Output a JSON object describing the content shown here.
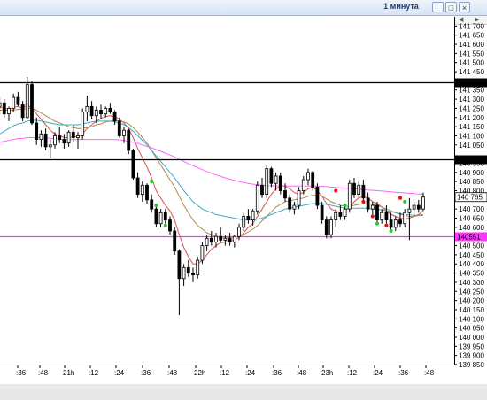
{
  "window": {
    "title": "1 минута"
  },
  "colors": {
    "candle_up": "#ffffff",
    "candle_down": "#000000",
    "ma_fast": "#d9534f",
    "ma_mid": "#3fa9c9",
    "ma_slow": "#ff66ff",
    "ma_brown": "#b08a4a",
    "level_line": "#000000",
    "support_line": "#ff33ff",
    "signal_red": "#ff0000",
    "signal_green": "#22cc22"
  },
  "chart_data": {
    "type": "candlestick",
    "title": "",
    "ylim": [
      139850,
      141750
    ],
    "y_tick_labels": [
      "141 700",
      "141 650",
      "141 600",
      "141 550",
      "141 500",
      "141 450",
      "141 350",
      "141 300",
      "141 250",
      "141 200",
      "141 150",
      "141 100",
      "141 050",
      "140 950",
      "140 900",
      "140 850",
      "140 800",
      "140 700",
      "140 650",
      "140 600",
      "140 500",
      "140 450",
      "140 400",
      "140 350",
      "140 300",
      "140 250",
      "140 200",
      "140 150",
      "140 100",
      "140 050",
      "140 000",
      "139 950",
      "139 900",
      "139 850"
    ],
    "y_ticks": [
      141700,
      141650,
      141600,
      141550,
      141500,
      141450,
      141350,
      141300,
      141250,
      141200,
      141150,
      141100,
      141050,
      140950,
      140900,
      140850,
      140800,
      140700,
      140650,
      140600,
      140500,
      140450,
      140400,
      140350,
      140300,
      140250,
      140200,
      140150,
      140100,
      140050,
      140000,
      139950,
      139900,
      139850
    ],
    "x_tick_labels": [
      ":36",
      ":48",
      "21h",
      ":12",
      ":24",
      ":36",
      ":48",
      "22h",
      ":12",
      ":24",
      ":36",
      ":48",
      "23h",
      ":12",
      ":24",
      ":36",
      ":48"
    ],
    "levels": [
      {
        "value": 141392,
        "label": "141392",
        "color": "#000000"
      },
      {
        "value": 140970,
        "label": "140970",
        "color": "#000000"
      },
      {
        "value": 140551,
        "label": "140551",
        "color": "#ff33ff"
      }
    ],
    "last_price": {
      "value": 140765,
      "label": "140 765"
    },
    "candles": [
      [
        141290,
        141320,
        141230,
        141260
      ],
      [
        141260,
        141300,
        141200,
        141240
      ],
      [
        141240,
        141280,
        141190,
        141260
      ],
      [
        141260,
        141310,
        141220,
        141280
      ],
      [
        141280,
        141300,
        141200,
        141220
      ],
      [
        141220,
        141260,
        141180,
        141250
      ],
      [
        141250,
        141330,
        141230,
        141310
      ],
      [
        141310,
        141340,
        141260,
        141270
      ],
      [
        141270,
        141290,
        141180,
        141200
      ],
      [
        141200,
        141420,
        141190,
        141380
      ],
      [
        141380,
        141400,
        141160,
        141170
      ],
      [
        141170,
        141200,
        141050,
        141080
      ],
      [
        141080,
        141130,
        141040,
        141110
      ],
      [
        141110,
        141140,
        141020,
        141040
      ],
      [
        141040,
        141080,
        140980,
        141050
      ],
      [
        141050,
        141120,
        141030,
        141100
      ],
      [
        141100,
        141150,
        141060,
        141080
      ],
      [
        141080,
        141110,
        141030,
        141060
      ],
      [
        141060,
        141130,
        141040,
        141120
      ],
      [
        141120,
        141160,
        141070,
        141090
      ],
      [
        141090,
        141120,
        141030,
        141100
      ],
      [
        141100,
        141250,
        141080,
        141230
      ],
      [
        141230,
        141320,
        141180,
        141260
      ],
      [
        141260,
        141290,
        141190,
        141210
      ],
      [
        141210,
        141260,
        141170,
        141240
      ],
      [
        141240,
        141270,
        141190,
        141220
      ],
      [
        141220,
        141260,
        141200,
        141250
      ],
      [
        141250,
        141280,
        141220,
        141230
      ],
      [
        141230,
        141240,
        141160,
        141180
      ],
      [
        141180,
        141200,
        141090,
        141100
      ],
      [
        141100,
        141150,
        141060,
        141130
      ],
      [
        141130,
        141140,
        141000,
        141020
      ],
      [
        141020,
        141030,
        140860,
        140870
      ],
      [
        140870,
        140900,
        140760,
        140780
      ],
      [
        140780,
        140850,
        140740,
        140830
      ],
      [
        140830,
        140840,
        140730,
        140750
      ],
      [
        140750,
        140780,
        140680,
        140700
      ],
      [
        140700,
        140720,
        140600,
        140620
      ],
      [
        140620,
        140700,
        140600,
        140680
      ],
      [
        140680,
        140700,
        140620,
        140640
      ],
      [
        140640,
        140660,
        140560,
        140580
      ],
      [
        140580,
        140600,
        140450,
        140470
      ],
      [
        140470,
        140480,
        140120,
        140320
      ],
      [
        140320,
        140400,
        140280,
        140380
      ],
      [
        140380,
        140420,
        140330,
        140350
      ],
      [
        140350,
        140380,
        140300,
        140340
      ],
      [
        140340,
        140440,
        140320,
        140420
      ],
      [
        140420,
        140520,
        140400,
        140500
      ],
      [
        140500,
        140560,
        140470,
        140540
      ],
      [
        140540,
        140580,
        140500,
        140520
      ],
      [
        140520,
        140570,
        140490,
        140550
      ],
      [
        140550,
        140600,
        140520,
        140530
      ],
      [
        140530,
        140560,
        140500,
        140540
      ],
      [
        140540,
        140570,
        140500,
        140520
      ],
      [
        140520,
        140560,
        140490,
        140550
      ],
      [
        140550,
        140620,
        140530,
        140600
      ],
      [
        140600,
        140680,
        140580,
        140660
      ],
      [
        140660,
        140700,
        140620,
        140640
      ],
      [
        140640,
        140700,
        140610,
        140690
      ],
      [
        140690,
        140850,
        140670,
        140830
      ],
      [
        140830,
        140870,
        140760,
        140780
      ],
      [
        140780,
        140940,
        140760,
        140920
      ],
      [
        140920,
        140930,
        140820,
        140840
      ],
      [
        140840,
        140900,
        140800,
        140880
      ],
      [
        140880,
        140900,
        140780,
        140800
      ],
      [
        140800,
        140840,
        140740,
        140760
      ],
      [
        140760,
        140780,
        140680,
        140700
      ],
      [
        140700,
        140740,
        140670,
        140720
      ],
      [
        140720,
        140820,
        140700,
        140800
      ],
      [
        140800,
        140880,
        140780,
        140860
      ],
      [
        140860,
        140920,
        140830,
        140900
      ],
      [
        140900,
        140910,
        140800,
        140820
      ],
      [
        140820,
        140840,
        140700,
        140720
      ],
      [
        140720,
        140740,
        140620,
        140640
      ],
      [
        140640,
        140660,
        140540,
        140560
      ],
      [
        140560,
        140660,
        140540,
        140640
      ],
      [
        140640,
        140700,
        140600,
        140680
      ],
      [
        140680,
        140720,
        140640,
        140660
      ],
      [
        140660,
        140720,
        140640,
        140700
      ],
      [
        140700,
        140860,
        140680,
        140840
      ],
      [
        140840,
        140870,
        140760,
        140780
      ],
      [
        140780,
        140850,
        140760,
        140830
      ],
      [
        140830,
        140860,
        140740,
        140760
      ],
      [
        140760,
        140790,
        140680,
        140700
      ],
      [
        140700,
        140740,
        140650,
        140720
      ],
      [
        140720,
        140740,
        140620,
        140640
      ],
      [
        140640,
        140700,
        140620,
        140680
      ],
      [
        140680,
        140720,
        140620,
        140640
      ],
      [
        140640,
        140680,
        140580,
        140600
      ],
      [
        140600,
        140660,
        140580,
        140640
      ],
      [
        140640,
        140680,
        140600,
        140620
      ],
      [
        140620,
        140700,
        140600,
        140680
      ],
      [
        140680,
        140760,
        140530,
        140700
      ],
      [
        140700,
        140740,
        140660,
        140720
      ],
      [
        140720,
        140750,
        140680,
        140700
      ],
      [
        140700,
        140790,
        140690,
        140765
      ]
    ],
    "series": [
      {
        "name": "",
        "color": "#d9534f",
        "values": [
          141260,
          141255,
          141250,
          141255,
          141250,
          141245,
          141255,
          141260,
          141250,
          141270,
          141250,
          141220,
          141190,
          141160,
          141130,
          141110,
          141100,
          141090,
          141090,
          141095,
          141095,
          141110,
          141140,
          141160,
          141180,
          141195,
          141205,
          141210,
          141205,
          141190,
          141170,
          141140,
          141090,
          141030,
          140980,
          140930,
          140870,
          140800,
          140760,
          140720,
          140690,
          140640,
          140560,
          140490,
          140440,
          140400,
          140400,
          140420,
          140450,
          140480,
          140500,
          140515,
          140520,
          140525,
          140530,
          140545,
          140570,
          140600,
          140620,
          140660,
          140700,
          140740,
          140780,
          140810,
          140825,
          140825,
          140810,
          140790,
          140780,
          140790,
          140810,
          140820,
          140800,
          140770,
          140730,
          140700,
          140690,
          140680,
          140690,
          140710,
          140740,
          140760,
          140770,
          140760,
          140740,
          140730,
          140710,
          140690,
          140670,
          140660,
          140650,
          140645,
          140650,
          140660,
          140670,
          140690
        ]
      },
      {
        "name": "",
        "color": "#b08a4a",
        "values": [
          141240,
          141240,
          141240,
          141240,
          141240,
          141240,
          141240,
          141245,
          141245,
          141250,
          141250,
          141240,
          141225,
          141210,
          141195,
          141180,
          141170,
          141160,
          141150,
          141145,
          141140,
          141140,
          141145,
          141150,
          141160,
          141165,
          141175,
          141180,
          141185,
          141180,
          141175,
          141165,
          141145,
          141120,
          141090,
          141060,
          141020,
          140980,
          140940,
          140900,
          140860,
          140820,
          140770,
          140720,
          140680,
          140640,
          140610,
          140590,
          140570,
          140560,
          140550,
          140545,
          140545,
          140545,
          140545,
          140550,
          140560,
          140575,
          140590,
          140610,
          140635,
          140660,
          140685,
          140710,
          140725,
          140740,
          140745,
          140750,
          140755,
          140760,
          140770,
          140775,
          140775,
          140770,
          140755,
          140740,
          140730,
          140720,
          140715,
          140715,
          140720,
          140725,
          140730,
          140730,
          140725,
          140720,
          140710,
          140700,
          140690,
          140680,
          140670,
          140665,
          140660,
          140660,
          140665,
          140670
        ]
      },
      {
        "name": "",
        "color": "#3fa9c9",
        "values": [
          141050,
          141070,
          141090,
          141110,
          141125,
          141140,
          141155,
          141165,
          141170,
          141180,
          141185,
          141185,
          141180,
          141175,
          141170,
          141165,
          141160,
          141160,
          141160,
          141160,
          141160,
          141165,
          141170,
          141175,
          141180,
          141180,
          141180,
          141180,
          141175,
          141170,
          141160,
          141145,
          141125,
          141100,
          141075,
          141050,
          141020,
          140990,
          140960,
          140930,
          140900,
          140870,
          140835,
          140800,
          140770,
          140740,
          140720,
          140700,
          140690,
          140680,
          140670,
          140665,
          140660,
          140655,
          140650,
          140645,
          140640,
          140640,
          140640,
          140645,
          140650,
          140660,
          140670,
          140680,
          140690,
          140700,
          140705,
          140710,
          140715,
          140720,
          140725,
          140730,
          140730,
          140730,
          140725,
          140720,
          140715,
          140710,
          140705,
          140705,
          140705,
          140705,
          140705,
          140705,
          140700,
          140700,
          140695,
          140690,
          140685,
          140680,
          140675,
          140670,
          140668,
          140666,
          140665,
          140665
        ]
      },
      {
        "name": "",
        "color": "#ff66ff",
        "values": [
          141050,
          141055,
          141060,
          141065,
          141070,
          141075,
          141080,
          141085,
          141085,
          141090,
          141090,
          141090,
          141090,
          141088,
          141086,
          141084,
          141082,
          141080,
          141080,
          141080,
          141080,
          141080,
          141080,
          141080,
          141080,
          141080,
          141080,
          141080,
          141080,
          141078,
          141075,
          141070,
          141065,
          141058,
          141050,
          141042,
          141034,
          141025,
          141015,
          141005,
          140995,
          140985,
          140972,
          140960,
          140948,
          140936,
          140925,
          140915,
          140905,
          140895,
          140886,
          140878,
          140870,
          140863,
          140856,
          140850,
          140845,
          140840,
          140836,
          140833,
          140830,
          140828,
          140827,
          140826,
          140826,
          140826,
          140826,
          140826,
          140826,
          140826,
          140826,
          140826,
          140825,
          140824,
          140822,
          140820,
          140818,
          140816,
          140814,
          140812,
          140810,
          140808,
          140806,
          140804,
          140802,
          140800,
          140798,
          140796,
          140794,
          140792,
          140790,
          140788,
          140786,
          140784,
          140782,
          140780
        ]
      }
    ],
    "signals": [
      {
        "index": 36,
        "type": "green",
        "price": 140850
      },
      {
        "index": 37,
        "type": "green",
        "price": 140720
      },
      {
        "index": 39,
        "type": "green",
        "price": 140610
      },
      {
        "index": 76,
        "type": "red",
        "price": 140800
      },
      {
        "index": 78,
        "type": "green",
        "price": 140720
      },
      {
        "index": 82,
        "type": "red",
        "price": 140740
      },
      {
        "index": 84,
        "type": "red",
        "price": 140660
      },
      {
        "index": 85,
        "type": "green",
        "price": 140620
      },
      {
        "index": 87,
        "type": "red",
        "price": 140610
      },
      {
        "index": 88,
        "type": "green",
        "price": 140580
      },
      {
        "index": 90,
        "type": "red",
        "price": 140760
      },
      {
        "index": 91,
        "type": "green",
        "price": 140740
      }
    ]
  }
}
